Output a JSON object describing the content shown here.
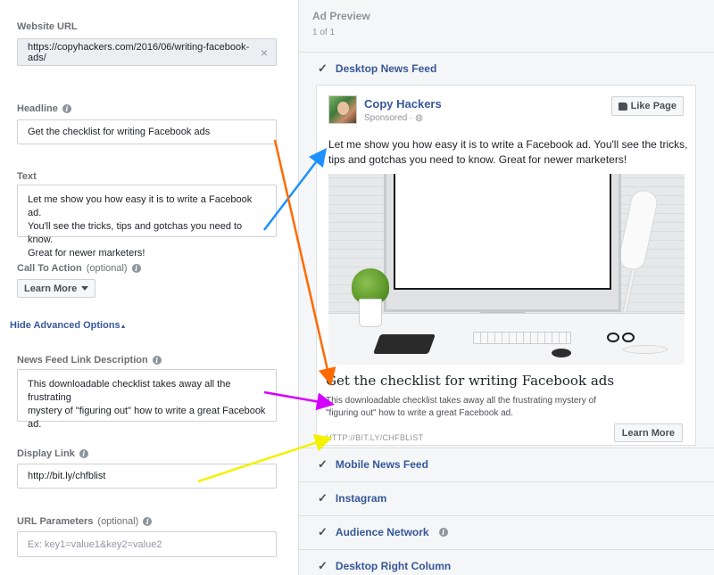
{
  "form": {
    "website_url": {
      "label": "Website URL",
      "value": "https://copyhackers.com/2016/06/writing-facebook-ads/"
    },
    "headline": {
      "label": "Headline",
      "value": "Get the checklist for writing Facebook ads"
    },
    "text": {
      "label": "Text",
      "value": "Let me show you how easy it is to write a Facebook ad.\nYou'll see the tricks, tips and gotchas you need to know.\nGreat for newer marketers!"
    },
    "call_to_action": {
      "label": "Call To Action",
      "optional": "(optional)",
      "value": "Learn More"
    },
    "advanced_toggle": "Hide Advanced Options",
    "link_description": {
      "label": "News Feed Link Description",
      "value": "This downloadable checklist takes away all the frustrating\nmystery of \"figuring out\" how to write a great Facebook\nad."
    },
    "display_link": {
      "label": "Display Link",
      "value": "http://bit.ly/chfblist"
    },
    "url_parameters": {
      "label": "URL Parameters",
      "optional": "(optional)",
      "placeholder": "Ex: key1=value1&key2=value2"
    }
  },
  "preview": {
    "title": "Ad Preview",
    "count": "1 of 1",
    "sections": [
      {
        "label": "Desktop News Feed"
      },
      {
        "label": "Mobile News Feed"
      },
      {
        "label": "Instagram"
      },
      {
        "label": "Audience Network"
      },
      {
        "label": "Desktop Right Column"
      }
    ],
    "ad": {
      "page_name": "Copy Hackers",
      "sponsored": "Sponsored · ",
      "like_label": "Like Page",
      "text": "Let me show you how easy it is to write a Facebook ad. You'll see the tricks, tips and gotchas you need to know. Great for newer marketers!",
      "headline": "Get the checklist for writing Facebook ads",
      "description": "This downloadable checklist takes away all the frustrating mystery of \"figuring out\" how to write a great Facebook ad.",
      "display_link": "HTTP://BIT.LY/CHFBLIST",
      "cta": "Learn More"
    }
  },
  "colors": {
    "link_blue": "#365899",
    "arrow_blue": "#1e90ff",
    "arrow_orange": "#ff6a00",
    "arrow_magenta": "#d400ff",
    "arrow_yellow": "#f2f200"
  }
}
